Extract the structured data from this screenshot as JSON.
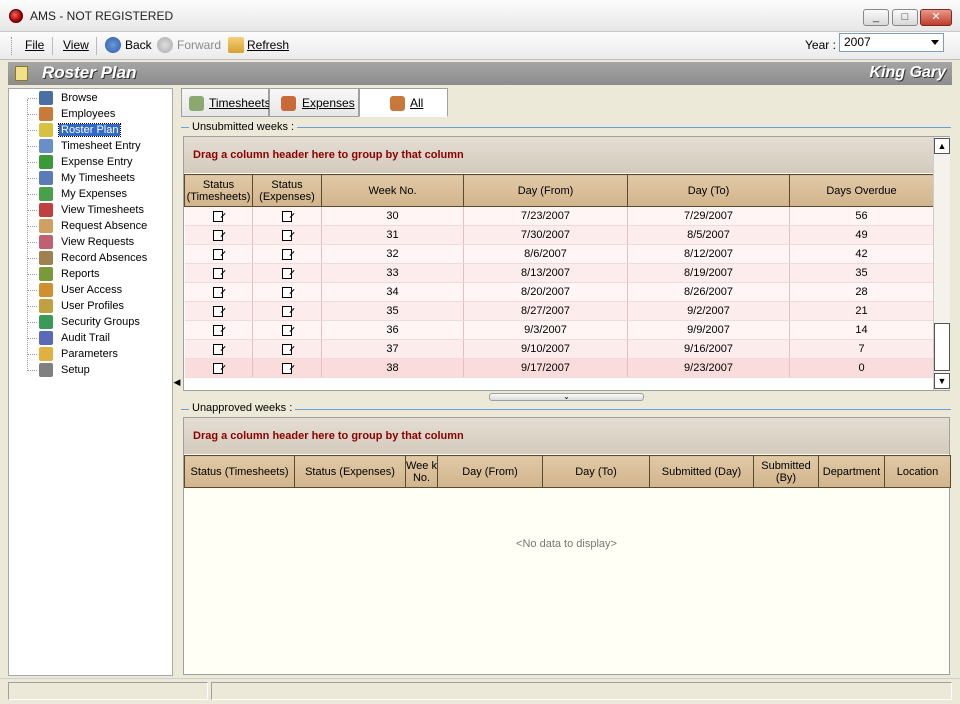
{
  "window": {
    "title": "AMS - NOT REGISTERED",
    "minimize": "_",
    "maximize": "□",
    "close": "✕"
  },
  "toolbar": {
    "file": "File",
    "view": "View",
    "back": "Back",
    "forward": "Forward",
    "refresh": "Refresh",
    "year_label": "Year :",
    "year_value": "2007"
  },
  "header": {
    "title": "Roster Plan",
    "user": "King Gary"
  },
  "sidebar": {
    "items": [
      {
        "label": "Browse",
        "icon": "binoculars-icon",
        "color": "#4a6fa5"
      },
      {
        "label": "Employees",
        "icon": "people-icon",
        "color": "#c87a3a"
      },
      {
        "label": "Roster Plan",
        "icon": "roster-icon",
        "color": "#d8c040"
      },
      {
        "label": "Timesheet Entry",
        "icon": "timesheet-icon",
        "color": "#6a8ec8"
      },
      {
        "label": "Expense Entry",
        "icon": "expense-icon",
        "color": "#3a9a3a"
      },
      {
        "label": "My Timesheets",
        "icon": "clock-icon",
        "color": "#5a7ab8"
      },
      {
        "label": "My Expenses",
        "icon": "money-icon",
        "color": "#4aa04a"
      },
      {
        "label": "View Timesheets",
        "icon": "checklist-icon",
        "color": "#c04040"
      },
      {
        "label": "Request Absence",
        "icon": "hand-icon",
        "color": "#d0a060"
      },
      {
        "label": "View Requests",
        "icon": "eye-icon",
        "color": "#c06070"
      },
      {
        "label": "Record Absences",
        "icon": "pencil-icon",
        "color": "#a08050"
      },
      {
        "label": "Reports",
        "icon": "reports-icon",
        "color": "#7a9a3a"
      },
      {
        "label": "User Access",
        "icon": "user-access-icon",
        "color": "#d09030"
      },
      {
        "label": "User Profiles",
        "icon": "user-profiles-icon",
        "color": "#c0a040"
      },
      {
        "label": "Security Groups",
        "icon": "security-icon",
        "color": "#3a9a5a"
      },
      {
        "label": "Audit Trail",
        "icon": "audit-icon",
        "color": "#5a6ab8"
      },
      {
        "label": "Parameters",
        "icon": "folder-icon",
        "color": "#e0b040"
      },
      {
        "label": "Setup",
        "icon": "tools-icon",
        "color": "#808080"
      }
    ]
  },
  "tabs": [
    {
      "label": "Timesheets",
      "icon": "timesheets-tab-icon",
      "color": "#8aa870"
    },
    {
      "label": "Expenses",
      "icon": "expenses-tab-icon",
      "color": "#c86a3a"
    },
    {
      "label": "All",
      "icon": "all-tab-icon",
      "color": "#c8783a"
    }
  ],
  "unsubmitted": {
    "label": "Unsubmitted weeks :",
    "group_hint": "Drag a column header here to group by that column",
    "columns": [
      "Status\n(Timesheets)",
      "Status\n(Expenses)",
      "Week No.",
      "Day (From)",
      "Day (To)",
      "Days Overdue"
    ],
    "rows": [
      {
        "week": "30",
        "from": "7/23/2007",
        "to": "7/29/2007",
        "overdue": "56"
      },
      {
        "week": "31",
        "from": "7/30/2007",
        "to": "8/5/2007",
        "overdue": "49"
      },
      {
        "week": "32",
        "from": "8/6/2007",
        "to": "8/12/2007",
        "overdue": "42"
      },
      {
        "week": "33",
        "from": "8/13/2007",
        "to": "8/19/2007",
        "overdue": "35"
      },
      {
        "week": "34",
        "from": "8/20/2007",
        "to": "8/26/2007",
        "overdue": "28"
      },
      {
        "week": "35",
        "from": "8/27/2007",
        "to": "9/2/2007",
        "overdue": "21"
      },
      {
        "week": "36",
        "from": "9/3/2007",
        "to": "9/9/2007",
        "overdue": "14"
      },
      {
        "week": "37",
        "from": "9/10/2007",
        "to": "9/16/2007",
        "overdue": "7"
      },
      {
        "week": "38",
        "from": "9/17/2007",
        "to": "9/23/2007",
        "overdue": "0"
      }
    ]
  },
  "unapproved": {
    "label": "Unapproved weeks :",
    "group_hint": "Drag a column header here to group by that column",
    "columns": [
      "Status (Timesheets)",
      "Status (Expenses)",
      "Wee k No.",
      "Day (From)",
      "Day (To)",
      "Submitted (Day)",
      "Submitted (By)",
      "Department",
      "Location"
    ],
    "empty_text": "<No data to display>"
  }
}
